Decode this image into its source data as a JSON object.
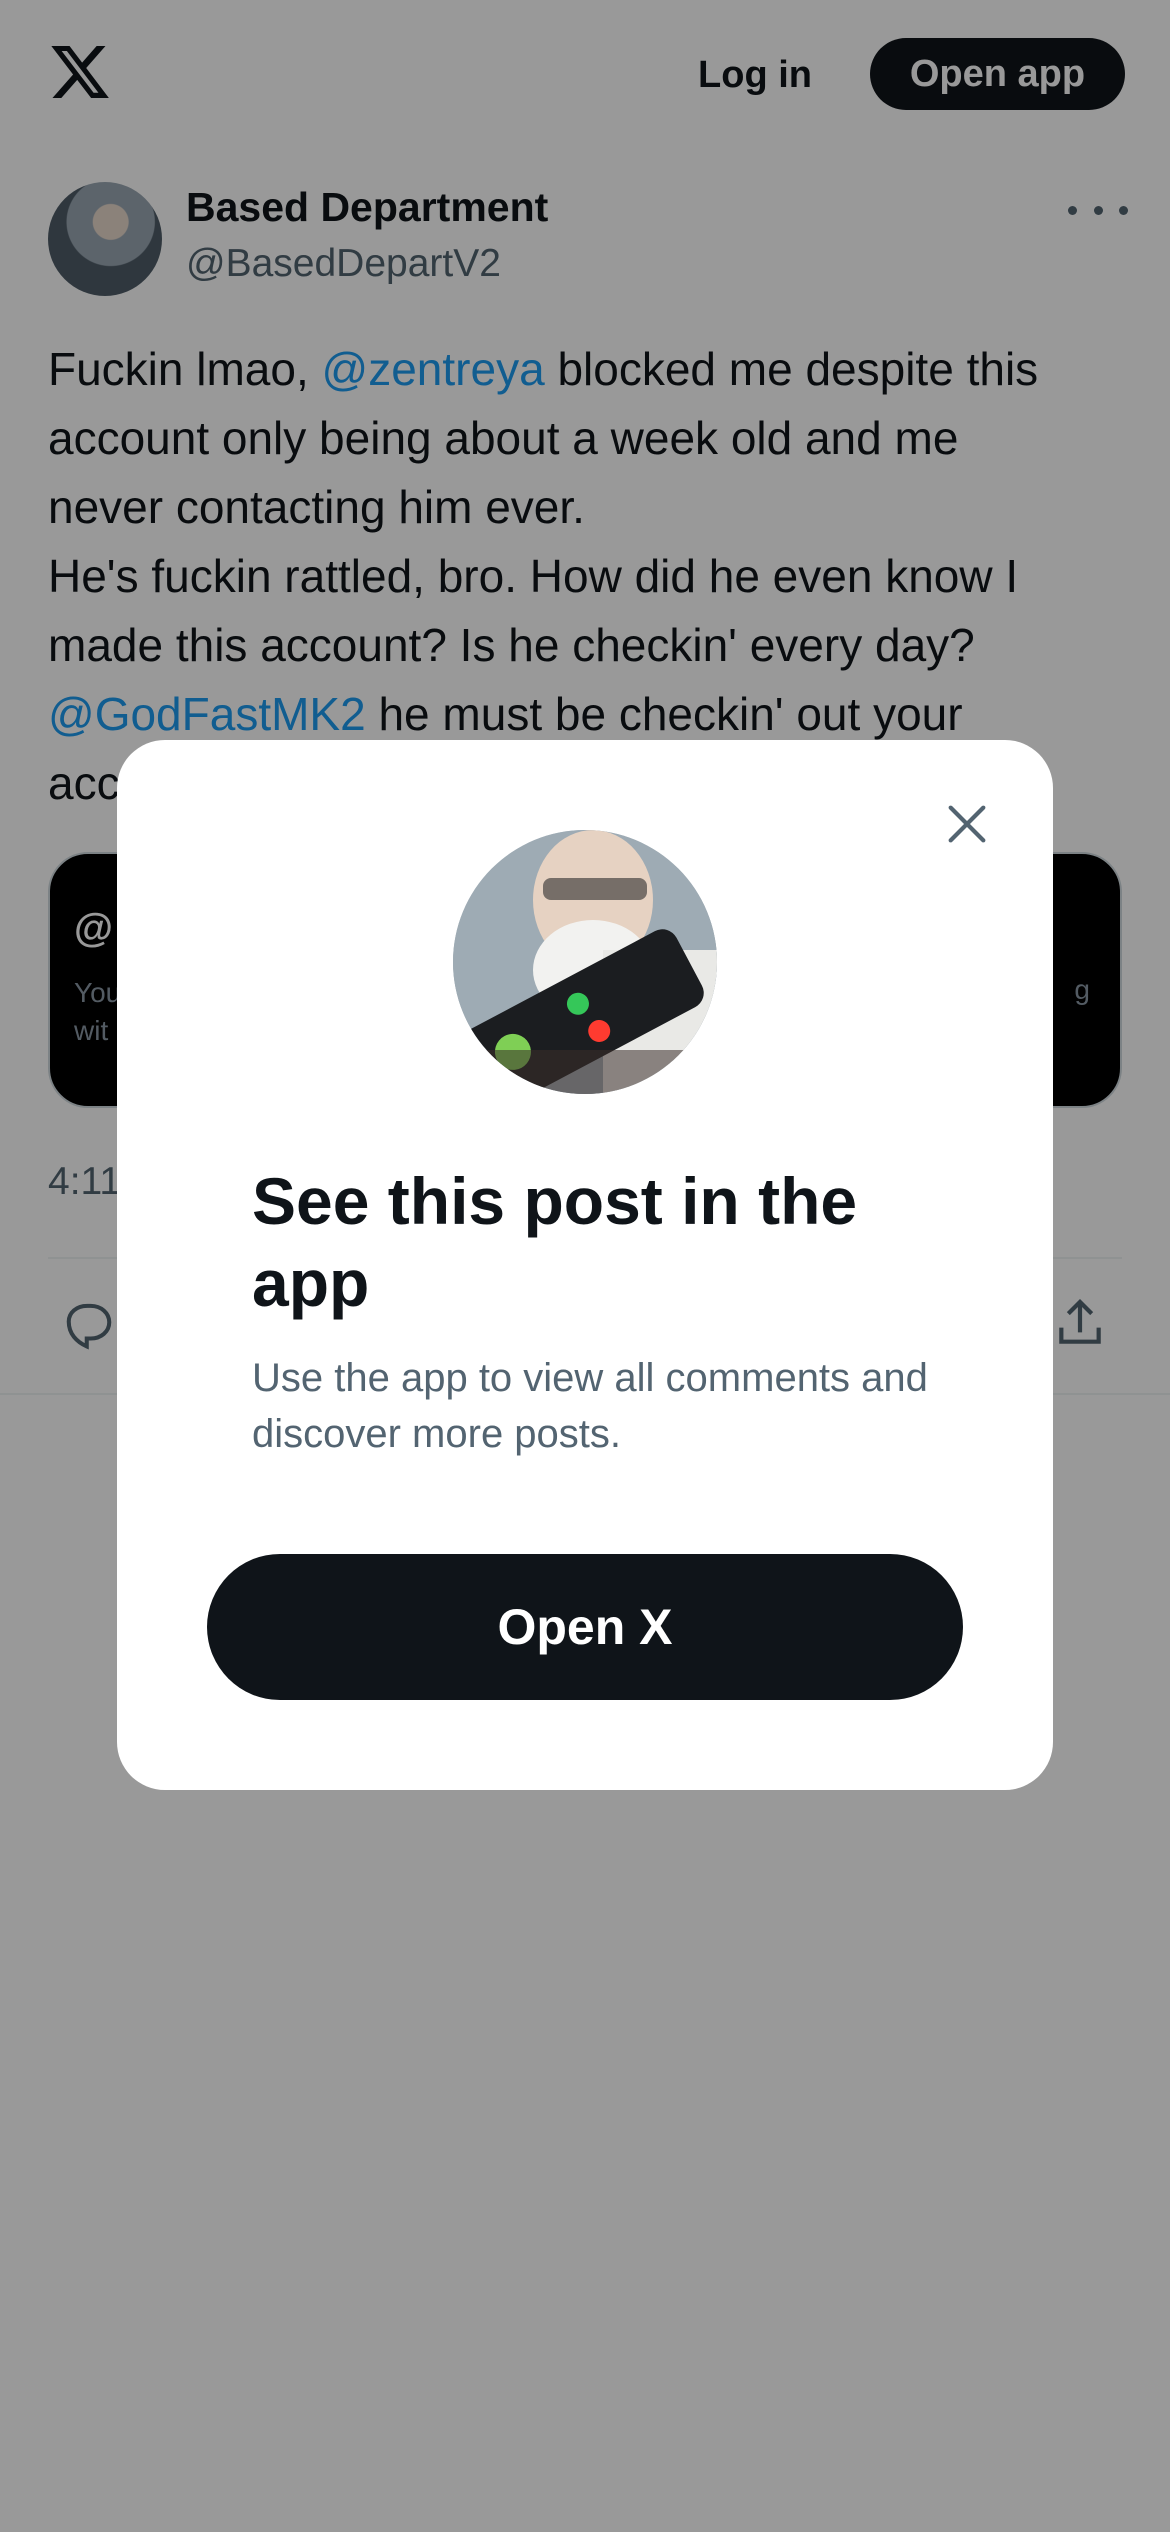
{
  "header": {
    "logo_icon": "x-logo-icon",
    "login_label": "Log in",
    "open_app_label": "Open app"
  },
  "post": {
    "author_name": "Based Department",
    "author_handle": "@BasedDepartV2",
    "more_icon": "more-horizontal-icon",
    "text_lines": [
      {
        "before": "Fuckin lmao, ",
        "mention": "@zentreya",
        "after": " blocked me despite this"
      },
      {
        "before": "account only being about a week old and me",
        "mention": "",
        "after": ""
      },
      {
        "before": "never contacting him ever.",
        "mention": "",
        "after": ""
      },
      {
        "before": "He's fuckin rattled, bro. How did he even know I",
        "mention": "",
        "after": ""
      },
      {
        "before": "made this account? Is he checkin' every day?",
        "mention": "",
        "after": ""
      },
      {
        "before": "",
        "mention": "@GodFastMK2",
        "after": " he must be checkin' out your"
      },
      {
        "before": "acc",
        "mention": "",
        "after": ""
      }
    ],
    "quote_card": {
      "visible_title": "@",
      "visible_line1": "You",
      "visible_line2": "wit",
      "visible_right": "g"
    },
    "time_partial": "4:11",
    "reply_icon": "reply-icon",
    "share_icon": "share-icon"
  },
  "modal": {
    "close_icon": "close-icon",
    "title": "See this post in the app",
    "subtitle": "Use the app to view all comments and discover more posts.",
    "button_label": "Open X"
  },
  "colors": {
    "text": "#0f1419",
    "muted": "#536471",
    "link": "#1d9bf0",
    "overlay": "rgba(0,0,0,0.4)"
  }
}
